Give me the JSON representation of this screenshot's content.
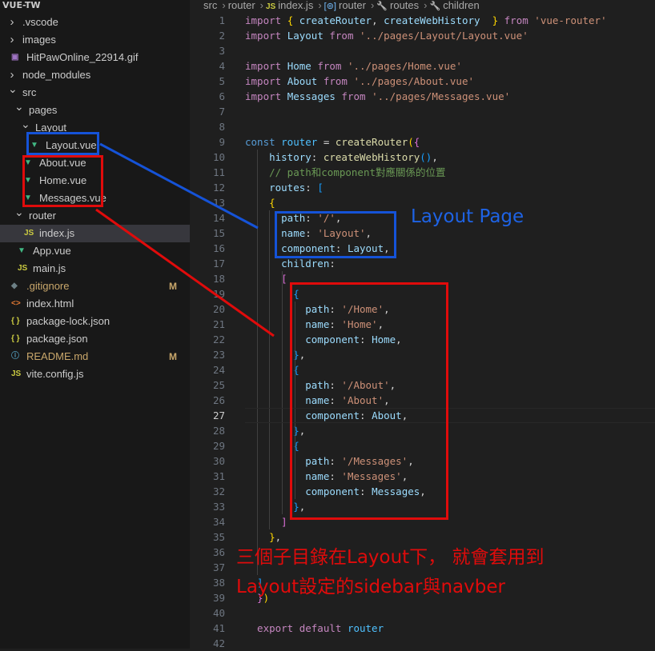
{
  "explorer": {
    "title": "VUE-TW",
    "items": [
      {
        "label": ".vscode",
        "kind": "folder",
        "state": "collapsed",
        "icon": "chevron-right-icon"
      },
      {
        "label": "images",
        "kind": "folder",
        "state": "collapsed",
        "icon": "chevron-right-icon"
      },
      {
        "label": "HitPawOnline_22914.gif",
        "kind": "file",
        "icon": "gif-file-icon"
      },
      {
        "label": "node_modules",
        "kind": "folder",
        "state": "collapsed",
        "icon": "chevron-right-icon"
      },
      {
        "label": "src",
        "kind": "folder",
        "state": "expanded",
        "icon": "chevron-down-icon"
      },
      {
        "label": "pages",
        "kind": "folder",
        "state": "expanded",
        "icon": "chevron-down-icon"
      },
      {
        "label": "Layout",
        "kind": "folder",
        "state": "expanded",
        "icon": "chevron-down-icon"
      },
      {
        "label": "Layout.vue",
        "kind": "file",
        "icon": "vue-file-icon"
      },
      {
        "label": "About.vue",
        "kind": "file",
        "icon": "vue-file-icon"
      },
      {
        "label": "Home.vue",
        "kind": "file",
        "icon": "vue-file-icon"
      },
      {
        "label": "Messages.vue",
        "kind": "file",
        "icon": "vue-file-icon"
      },
      {
        "label": "router",
        "kind": "folder",
        "state": "expanded",
        "icon": "chevron-down-icon"
      },
      {
        "label": "index.js",
        "kind": "file",
        "icon": "js-file-icon",
        "active": true
      },
      {
        "label": "App.vue",
        "kind": "file",
        "icon": "vue-file-icon"
      },
      {
        "label": "main.js",
        "kind": "file",
        "icon": "js-file-icon"
      },
      {
        "label": ".gitignore",
        "kind": "file",
        "icon": "git-file-icon",
        "status": "M"
      },
      {
        "label": "index.html",
        "kind": "file",
        "icon": "html-file-icon"
      },
      {
        "label": "package-lock.json",
        "kind": "file",
        "icon": "json-file-icon"
      },
      {
        "label": "package.json",
        "kind": "file",
        "icon": "json-file-icon"
      },
      {
        "label": "README.md",
        "kind": "file",
        "icon": "info-file-icon",
        "status": "M"
      },
      {
        "label": "vite.config.js",
        "kind": "file",
        "icon": "js-file-icon"
      }
    ]
  },
  "breadcrumb": {
    "items": [
      "src",
      "router",
      "index.js",
      "router",
      "routes",
      "children"
    ],
    "icons": [
      "",
      "",
      "js-file-icon",
      "symbol-variable-icon",
      "wrench-icon",
      "wrench-icon"
    ]
  },
  "editor": {
    "current_line": 27,
    "lines": [
      [
        [
          "import ",
          "kw"
        ],
        [
          "{ ",
          "br1"
        ],
        [
          "createRouter",
          "var"
        ],
        [
          ", ",
          ""
        ],
        [
          "createWebHistory",
          "var"
        ],
        [
          "  } ",
          "br1"
        ],
        [
          "from ",
          "kw"
        ],
        [
          "'vue-router'",
          "str"
        ]
      ],
      [
        [
          "import ",
          "kw"
        ],
        [
          "Layout ",
          "var"
        ],
        [
          "from ",
          "kw"
        ],
        [
          "'../pages/Layout/Layout.vue'",
          "str"
        ]
      ],
      [],
      [
        [
          "import ",
          "kw"
        ],
        [
          "Home ",
          "var"
        ],
        [
          "from ",
          "kw"
        ],
        [
          "'../pages/Home.vue'",
          "str"
        ]
      ],
      [
        [
          "import ",
          "kw"
        ],
        [
          "About ",
          "var"
        ],
        [
          "from ",
          "kw"
        ],
        [
          "'../pages/About.vue'",
          "str"
        ]
      ],
      [
        [
          "import ",
          "kw"
        ],
        [
          "Messages ",
          "var"
        ],
        [
          "from ",
          "kw"
        ],
        [
          "'../pages/Messages.vue'",
          "str"
        ]
      ],
      [],
      [],
      [
        [
          "const ",
          "kb"
        ],
        [
          "router ",
          "cls"
        ],
        [
          "= ",
          ""
        ],
        [
          "createRouter",
          "fn"
        ],
        [
          "(",
          "br1"
        ],
        [
          "{",
          "br2"
        ]
      ],
      [
        [
          "    history",
          "var"
        ],
        [
          ": ",
          ""
        ],
        [
          "createWebHistory",
          "fn"
        ],
        [
          "()",
          "br3"
        ],
        [
          ",",
          ""
        ]
      ],
      [
        [
          "    // path和component對應關係的位置",
          "cmt"
        ]
      ],
      [
        [
          "    routes",
          "var"
        ],
        [
          ": ",
          ""
        ],
        [
          "[",
          "br3"
        ]
      ],
      [
        [
          "    {",
          "br1"
        ]
      ],
      [
        [
          "      path",
          "var"
        ],
        [
          ": ",
          ""
        ],
        [
          "'/'",
          "str"
        ],
        [
          ",",
          ""
        ]
      ],
      [
        [
          "      name",
          "var"
        ],
        [
          ": ",
          ""
        ],
        [
          "'Layout'",
          "str"
        ],
        [
          ",",
          ""
        ]
      ],
      [
        [
          "      component",
          "var"
        ],
        [
          ": ",
          ""
        ],
        [
          "Layout",
          "var"
        ],
        [
          ",",
          ""
        ]
      ],
      [
        [
          "      children",
          "var"
        ],
        [
          ":",
          ""
        ]
      ],
      [
        [
          "      [",
          "br2"
        ]
      ],
      [
        [
          "        {",
          "br3"
        ]
      ],
      [
        [
          "          path",
          "var"
        ],
        [
          ": ",
          ""
        ],
        [
          "'/Home'",
          "str"
        ],
        [
          ",",
          ""
        ]
      ],
      [
        [
          "          name",
          "var"
        ],
        [
          ": ",
          ""
        ],
        [
          "'Home'",
          "str"
        ],
        [
          ",",
          ""
        ]
      ],
      [
        [
          "          component",
          "var"
        ],
        [
          ": ",
          ""
        ],
        [
          "Home",
          "var"
        ],
        [
          ",",
          ""
        ]
      ],
      [
        [
          "        }",
          "br3"
        ],
        [
          ",",
          ""
        ]
      ],
      [
        [
          "        {",
          "br3"
        ]
      ],
      [
        [
          "          path",
          "var"
        ],
        [
          ": ",
          ""
        ],
        [
          "'/About'",
          "str"
        ],
        [
          ",",
          ""
        ]
      ],
      [
        [
          "          name",
          "var"
        ],
        [
          ": ",
          ""
        ],
        [
          "'About'",
          "str"
        ],
        [
          ",",
          ""
        ]
      ],
      [
        [
          "          component",
          "var"
        ],
        [
          ": ",
          ""
        ],
        [
          "About",
          "var"
        ],
        [
          ",",
          ""
        ]
      ],
      [
        [
          "        }",
          "br3"
        ],
        [
          ",",
          ""
        ]
      ],
      [
        [
          "        {",
          "br3"
        ]
      ],
      [
        [
          "          path",
          "var"
        ],
        [
          ": ",
          ""
        ],
        [
          "'/Messages'",
          "str"
        ],
        [
          ",",
          ""
        ]
      ],
      [
        [
          "          name",
          "var"
        ],
        [
          ": ",
          ""
        ],
        [
          "'Messages'",
          "str"
        ],
        [
          ",",
          ""
        ]
      ],
      [
        [
          "          component",
          "var"
        ],
        [
          ": ",
          ""
        ],
        [
          "Messages",
          "var"
        ],
        [
          ",",
          ""
        ]
      ],
      [
        [
          "        }",
          "br3"
        ],
        [
          ",",
          ""
        ]
      ],
      [
        [
          "      ]",
          "br2"
        ]
      ],
      [
        [
          "    }",
          "br1"
        ],
        [
          ",",
          ""
        ]
      ],
      [],
      [],
      [
        [
          "  ]",
          "br3"
        ]
      ],
      [
        [
          "  }",
          "br2"
        ],
        [
          ")",
          "br1"
        ]
      ],
      [],
      [
        [
          "  export ",
          "kw"
        ],
        [
          "default ",
          "kw"
        ],
        [
          "router",
          "cls"
        ]
      ],
      []
    ]
  },
  "annotations": {
    "layout_page_label": "Layout Page",
    "note_line1": "三個子目錄在Layout下， 就會套用到",
    "note_line2": "Layout設定的sidebar與navber",
    "blue": "#1553d8",
    "red": "#e00b0b"
  }
}
